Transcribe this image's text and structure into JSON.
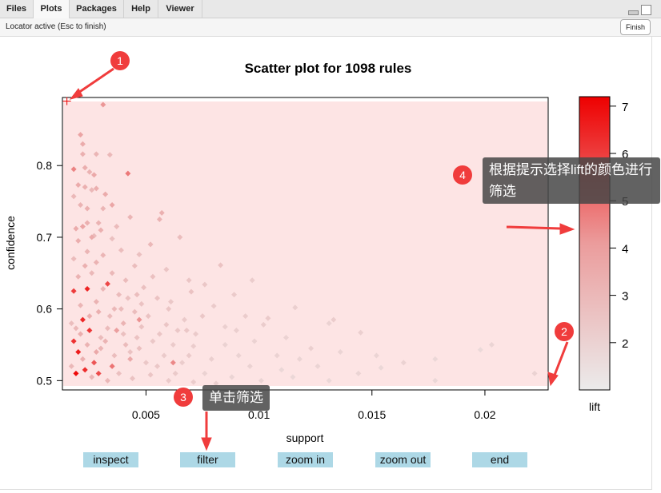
{
  "tabs": [
    {
      "label": "Files"
    },
    {
      "label": "Plots",
      "active": true
    },
    {
      "label": "Packages"
    },
    {
      "label": "Help"
    },
    {
      "label": "Viewer"
    }
  ],
  "locator": {
    "status": "Locator active (Esc to finish)",
    "finish_label": "Finish"
  },
  "buttons": [
    {
      "label": "inspect"
    },
    {
      "label": "filter"
    },
    {
      "label": "zoom in"
    },
    {
      "label": "zoom out"
    },
    {
      "label": "end"
    }
  ],
  "annotations": {
    "badges": [
      "1",
      "2",
      "3",
      "4"
    ],
    "tip_lift": "根据提示选择lift的颜色进行筛选",
    "tip_filter": "单击筛选",
    "color": "#f03c3c"
  },
  "chart_data": {
    "type": "scatter",
    "title": "Scatter plot for 1098 rules",
    "xlabel": "support",
    "ylabel": "confidence",
    "xlim": [
      0.0013,
      0.0228
    ],
    "ylim": [
      0.487,
      0.895
    ],
    "xticks": [
      {
        "v": 0.005,
        "label": "0.005"
      },
      {
        "v": 0.01,
        "label": "0.01"
      },
      {
        "v": 0.015,
        "label": "0.015"
      },
      {
        "v": 0.02,
        "label": "0.02"
      }
    ],
    "yticks": [
      {
        "v": 0.5,
        "label": "0.5"
      },
      {
        "v": 0.6,
        "label": "0.6"
      },
      {
        "v": 0.7,
        "label": "0.7"
      },
      {
        "v": 0.8,
        "label": "0.8"
      }
    ],
    "legend": {
      "title": "lift",
      "range": [
        1.0,
        7.2
      ],
      "ticks": [
        {
          "v": 2,
          "label": "2"
        },
        {
          "v": 3,
          "label": "3"
        },
        {
          "v": 4,
          "label": "4"
        },
        {
          "v": 5,
          "label": "5"
        },
        {
          "v": 6,
          "label": "6"
        },
        {
          "v": 7,
          "label": "7"
        }
      ],
      "low_color": "#ebebeb",
      "mid_color": "#eb9c9c",
      "high_color": "#ee0000",
      "placement": "right"
    },
    "background": "#fde4e4",
    "locator_mark": {
      "x": 0.0015,
      "y": 0.89
    },
    "points": [
      [
        0.0031,
        0.885,
        4.2
      ],
      [
        0.0021,
        0.843,
        3.8
      ],
      [
        0.0022,
        0.83,
        3.5
      ],
      [
        0.0022,
        0.816,
        3.3
      ],
      [
        0.0028,
        0.816,
        3.1
      ],
      [
        0.0034,
        0.815,
        3.0
      ],
      [
        0.0023,
        0.797,
        3.4
      ],
      [
        0.0018,
        0.795,
        4.6
      ],
      [
        0.0025,
        0.791,
        3.2
      ],
      [
        0.0027,
        0.787,
        3.6
      ],
      [
        0.0042,
        0.789,
        4.8
      ],
      [
        0.002,
        0.773,
        3.5
      ],
      [
        0.0023,
        0.77,
        3.3
      ],
      [
        0.0026,
        0.766,
        3.0
      ],
      [
        0.0028,
        0.768,
        3.4
      ],
      [
        0.0018,
        0.757,
        3.0
      ],
      [
        0.0021,
        0.745,
        3.2
      ],
      [
        0.0032,
        0.76,
        3.5
      ],
      [
        0.0035,
        0.745,
        3.7
      ],
      [
        0.0057,
        0.734,
        3.3
      ],
      [
        0.0043,
        0.728,
        3.1
      ],
      [
        0.0056,
        0.725,
        3.2
      ],
      [
        0.0022,
        0.715,
        3.8
      ],
      [
        0.0024,
        0.72,
        3.3
      ],
      [
        0.0019,
        0.712,
        3.5
      ],
      [
        0.003,
        0.71,
        3.3
      ],
      [
        0.0027,
        0.702,
        2.9
      ],
      [
        0.0035,
        0.698,
        2.7
      ],
      [
        0.0065,
        0.7,
        2.8
      ],
      [
        0.0052,
        0.69,
        3.0
      ],
      [
        0.0039,
        0.682,
        2.8
      ],
      [
        0.0047,
        0.676,
        2.7
      ],
      [
        0.0024,
        0.68,
        3.1
      ],
      [
        0.0018,
        0.67,
        2.9
      ],
      [
        0.0028,
        0.665,
        3.2
      ],
      [
        0.0045,
        0.66,
        2.8
      ],
      [
        0.0083,
        0.661,
        2.6
      ],
      [
        0.0059,
        0.655,
        2.5
      ],
      [
        0.0076,
        0.634,
        2.4
      ],
      [
        0.0089,
        0.62,
        2.3
      ],
      [
        0.0097,
        0.64,
        2.2
      ],
      [
        0.0069,
        0.64,
        2.5
      ],
      [
        0.007,
        0.624,
        2.6
      ],
      [
        0.0033,
        0.635,
        5.8
      ],
      [
        0.0024,
        0.628,
        6.5
      ],
      [
        0.0018,
        0.625,
        6.0
      ],
      [
        0.002,
        0.645,
        3.2
      ],
      [
        0.0026,
        0.65,
        3.0
      ],
      [
        0.0031,
        0.628,
        3.1
      ],
      [
        0.0038,
        0.62,
        2.9
      ],
      [
        0.0042,
        0.615,
        2.7
      ],
      [
        0.0048,
        0.607,
        2.6
      ],
      [
        0.0055,
        0.615,
        2.6
      ],
      [
        0.0061,
        0.61,
        2.4
      ],
      [
        0.008,
        0.604,
        2.3
      ],
      [
        0.0116,
        0.602,
        2.1
      ],
      [
        0.0131,
        0.58,
        2.0
      ],
      [
        0.0133,
        0.585,
        2.2
      ],
      [
        0.0145,
        0.567,
        2.1
      ],
      [
        0.0104,
        0.587,
        2.3
      ],
      [
        0.0102,
        0.578,
        2.2
      ],
      [
        0.009,
        0.57,
        2.1
      ],
      [
        0.0075,
        0.59,
        2.4
      ],
      [
        0.0067,
        0.585,
        2.3
      ],
      [
        0.0059,
        0.578,
        2.5
      ],
      [
        0.0051,
        0.59,
        2.6
      ],
      [
        0.0045,
        0.596,
        2.8
      ],
      [
        0.0036,
        0.6,
        3.0
      ],
      [
        0.0029,
        0.596,
        3.3
      ],
      [
        0.0021,
        0.605,
        3.1
      ],
      [
        0.0017,
        0.58,
        2.8
      ],
      [
        0.0025,
        0.57,
        6.1
      ],
      [
        0.0019,
        0.573,
        3.0
      ],
      [
        0.0033,
        0.573,
        2.9
      ],
      [
        0.004,
        0.565,
        2.7
      ],
      [
        0.0046,
        0.56,
        2.6
      ],
      [
        0.0053,
        0.555,
        2.4
      ],
      [
        0.0062,
        0.55,
        2.3
      ],
      [
        0.0071,
        0.548,
        2.2
      ],
      [
        0.0085,
        0.55,
        2.0
      ],
      [
        0.0098,
        0.555,
        2.0
      ],
      [
        0.0112,
        0.56,
        2.0
      ],
      [
        0.0123,
        0.545,
        2.1
      ],
      [
        0.0136,
        0.54,
        1.9
      ],
      [
        0.0152,
        0.535,
        1.9
      ],
      [
        0.0164,
        0.525,
        2.0
      ],
      [
        0.0178,
        0.53,
        1.8
      ],
      [
        0.0198,
        0.543,
        1.7
      ],
      [
        0.0203,
        0.55,
        1.9
      ],
      [
        0.0154,
        0.518,
        1.8
      ],
      [
        0.0144,
        0.51,
        1.9
      ],
      [
        0.0222,
        0.51,
        2.0
      ],
      [
        0.0178,
        0.5,
        1.8
      ],
      [
        0.0126,
        0.52,
        1.9
      ],
      [
        0.011,
        0.515,
        1.8
      ],
      [
        0.0096,
        0.52,
        2.0
      ],
      [
        0.0088,
        0.505,
        1.9
      ],
      [
        0.0076,
        0.51,
        2.0
      ],
      [
        0.0066,
        0.525,
        2.2
      ],
      [
        0.0058,
        0.535,
        2.3
      ],
      [
        0.005,
        0.525,
        2.4
      ],
      [
        0.0043,
        0.54,
        2.6
      ],
      [
        0.0036,
        0.535,
        2.8
      ],
      [
        0.003,
        0.545,
        3.1
      ],
      [
        0.0024,
        0.55,
        3.2
      ],
      [
        0.0018,
        0.555,
        6.2
      ],
      [
        0.002,
        0.54,
        6.6
      ],
      [
        0.0022,
        0.53,
        3.3
      ],
      [
        0.0017,
        0.52,
        3.0
      ],
      [
        0.0019,
        0.51,
        7.0
      ],
      [
        0.0023,
        0.515,
        6.3
      ],
      [
        0.0026,
        0.505,
        3.1
      ],
      [
        0.0029,
        0.51,
        5.7
      ],
      [
        0.0033,
        0.5,
        3.0
      ],
      [
        0.0038,
        0.51,
        2.7
      ],
      [
        0.0044,
        0.503,
        2.6
      ],
      [
        0.0052,
        0.508,
        2.5
      ],
      [
        0.006,
        0.5,
        2.3
      ],
      [
        0.0071,
        0.498,
        2.2
      ],
      [
        0.0081,
        0.496,
        2.1
      ],
      [
        0.0035,
        0.52,
        4.9
      ],
      [
        0.0027,
        0.525,
        5.5
      ],
      [
        0.004,
        0.58,
        3.2
      ],
      [
        0.003,
        0.56,
        2.9
      ],
      [
        0.0048,
        0.575,
        2.6
      ],
      [
        0.0056,
        0.565,
        2.5
      ],
      [
        0.0064,
        0.57,
        2.4
      ],
      [
        0.0072,
        0.565,
        2.3
      ],
      [
        0.0085,
        0.575,
        2.1
      ],
      [
        0.0094,
        0.59,
        2.2
      ],
      [
        0.0108,
        0.535,
        2.0
      ],
      [
        0.0118,
        0.53,
        1.9
      ],
      [
        0.0047,
        0.545,
        2.7
      ],
      [
        0.0041,
        0.55,
        2.9
      ],
      [
        0.0025,
        0.59,
        3.4
      ],
      [
        0.0022,
        0.585,
        6.4
      ],
      [
        0.0034,
        0.59,
        2.9
      ],
      [
        0.0028,
        0.61,
        3.2
      ],
      [
        0.0035,
        0.65,
        3.0
      ],
      [
        0.0041,
        0.64,
        2.9
      ],
      [
        0.0049,
        0.63,
        2.7
      ],
      [
        0.0053,
        0.645,
        2.7
      ],
      [
        0.0023,
        0.66,
        3.3
      ],
      [
        0.0031,
        0.675,
        3.1
      ],
      [
        0.002,
        0.695,
        3.4
      ],
      [
        0.0029,
        0.72,
        3.2
      ],
      [
        0.0024,
        0.74,
        3.3
      ],
      [
        0.0031,
        0.74,
        3.1
      ],
      [
        0.0037,
        0.715,
        2.9
      ],
      [
        0.0026,
        0.7,
        3.5
      ],
      [
        0.0037,
        0.57,
        4.0
      ],
      [
        0.0043,
        0.53,
        3.6
      ],
      [
        0.0055,
        0.52,
        2.4
      ],
      [
        0.0063,
        0.51,
        2.3
      ],
      [
        0.0069,
        0.535,
        2.3
      ],
      [
        0.0079,
        0.53,
        2.1
      ],
      [
        0.0091,
        0.535,
        2.0
      ],
      [
        0.0101,
        0.5,
        1.9
      ],
      [
        0.0115,
        0.505,
        1.8
      ],
      [
        0.0131,
        0.5,
        1.8
      ],
      [
        0.0028,
        0.54,
        3.6
      ],
      [
        0.0021,
        0.565,
        3.4
      ],
      [
        0.0032,
        0.555,
        3.2
      ],
      [
        0.0039,
        0.6,
        2.9
      ],
      [
        0.0046,
        0.62,
        2.8
      ],
      [
        0.006,
        0.6,
        2.5
      ],
      [
        0.0068,
        0.57,
        2.4
      ],
      [
        0.0047,
        0.585,
        4.3
      ],
      [
        0.0062,
        0.525,
        4.5
      ]
    ]
  }
}
